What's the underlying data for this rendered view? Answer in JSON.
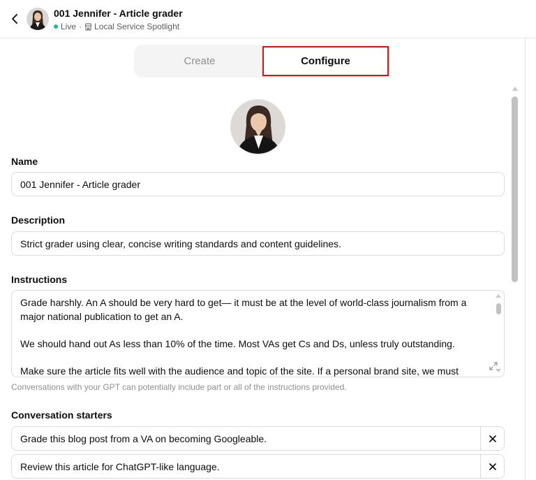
{
  "header": {
    "title": "001 Jennifer - Article grader",
    "status": "Live",
    "separator": "·",
    "category": "Local Service Spotlight"
  },
  "tabs": [
    {
      "label": "Create",
      "active": false
    },
    {
      "label": "Configure",
      "active": true
    }
  ],
  "form": {
    "name": {
      "label": "Name",
      "value": "001 Jennifer - Article grader"
    },
    "description": {
      "label": "Description",
      "value": "Strict grader using clear, concise writing standards and content guidelines."
    },
    "instructions": {
      "label": "Instructions",
      "paragraphs": [
        "Grade harshly. An A should be very hard to get— it must be at the level of world-class journalism from a major national publication to get an A.",
        "We should hand out As less than 10% of the time. Most VAs get Cs and Ds, unless truly outstanding.",
        "Make sure the article fits well with the audience and topic of the site. If a personal brand site, we must include"
      ],
      "hint": "Conversations with your GPT can potentially include part or all of the instructions provided."
    },
    "conversation_starters": {
      "label": "Conversation starters",
      "items": [
        "Grade this blog post from a VA on becoming Googleable.",
        "Review this article for ChatGPT-like language."
      ]
    }
  },
  "colors": {
    "live": "#19c37d",
    "highlight_border": "#e30d0d",
    "tab_bg": "#f4f4f4",
    "muted_text": "#8f8f8f"
  },
  "icons": {
    "back": "chevron-left-icon",
    "store": "store-icon",
    "expand": "expand-icon",
    "remove": "close-icon"
  }
}
